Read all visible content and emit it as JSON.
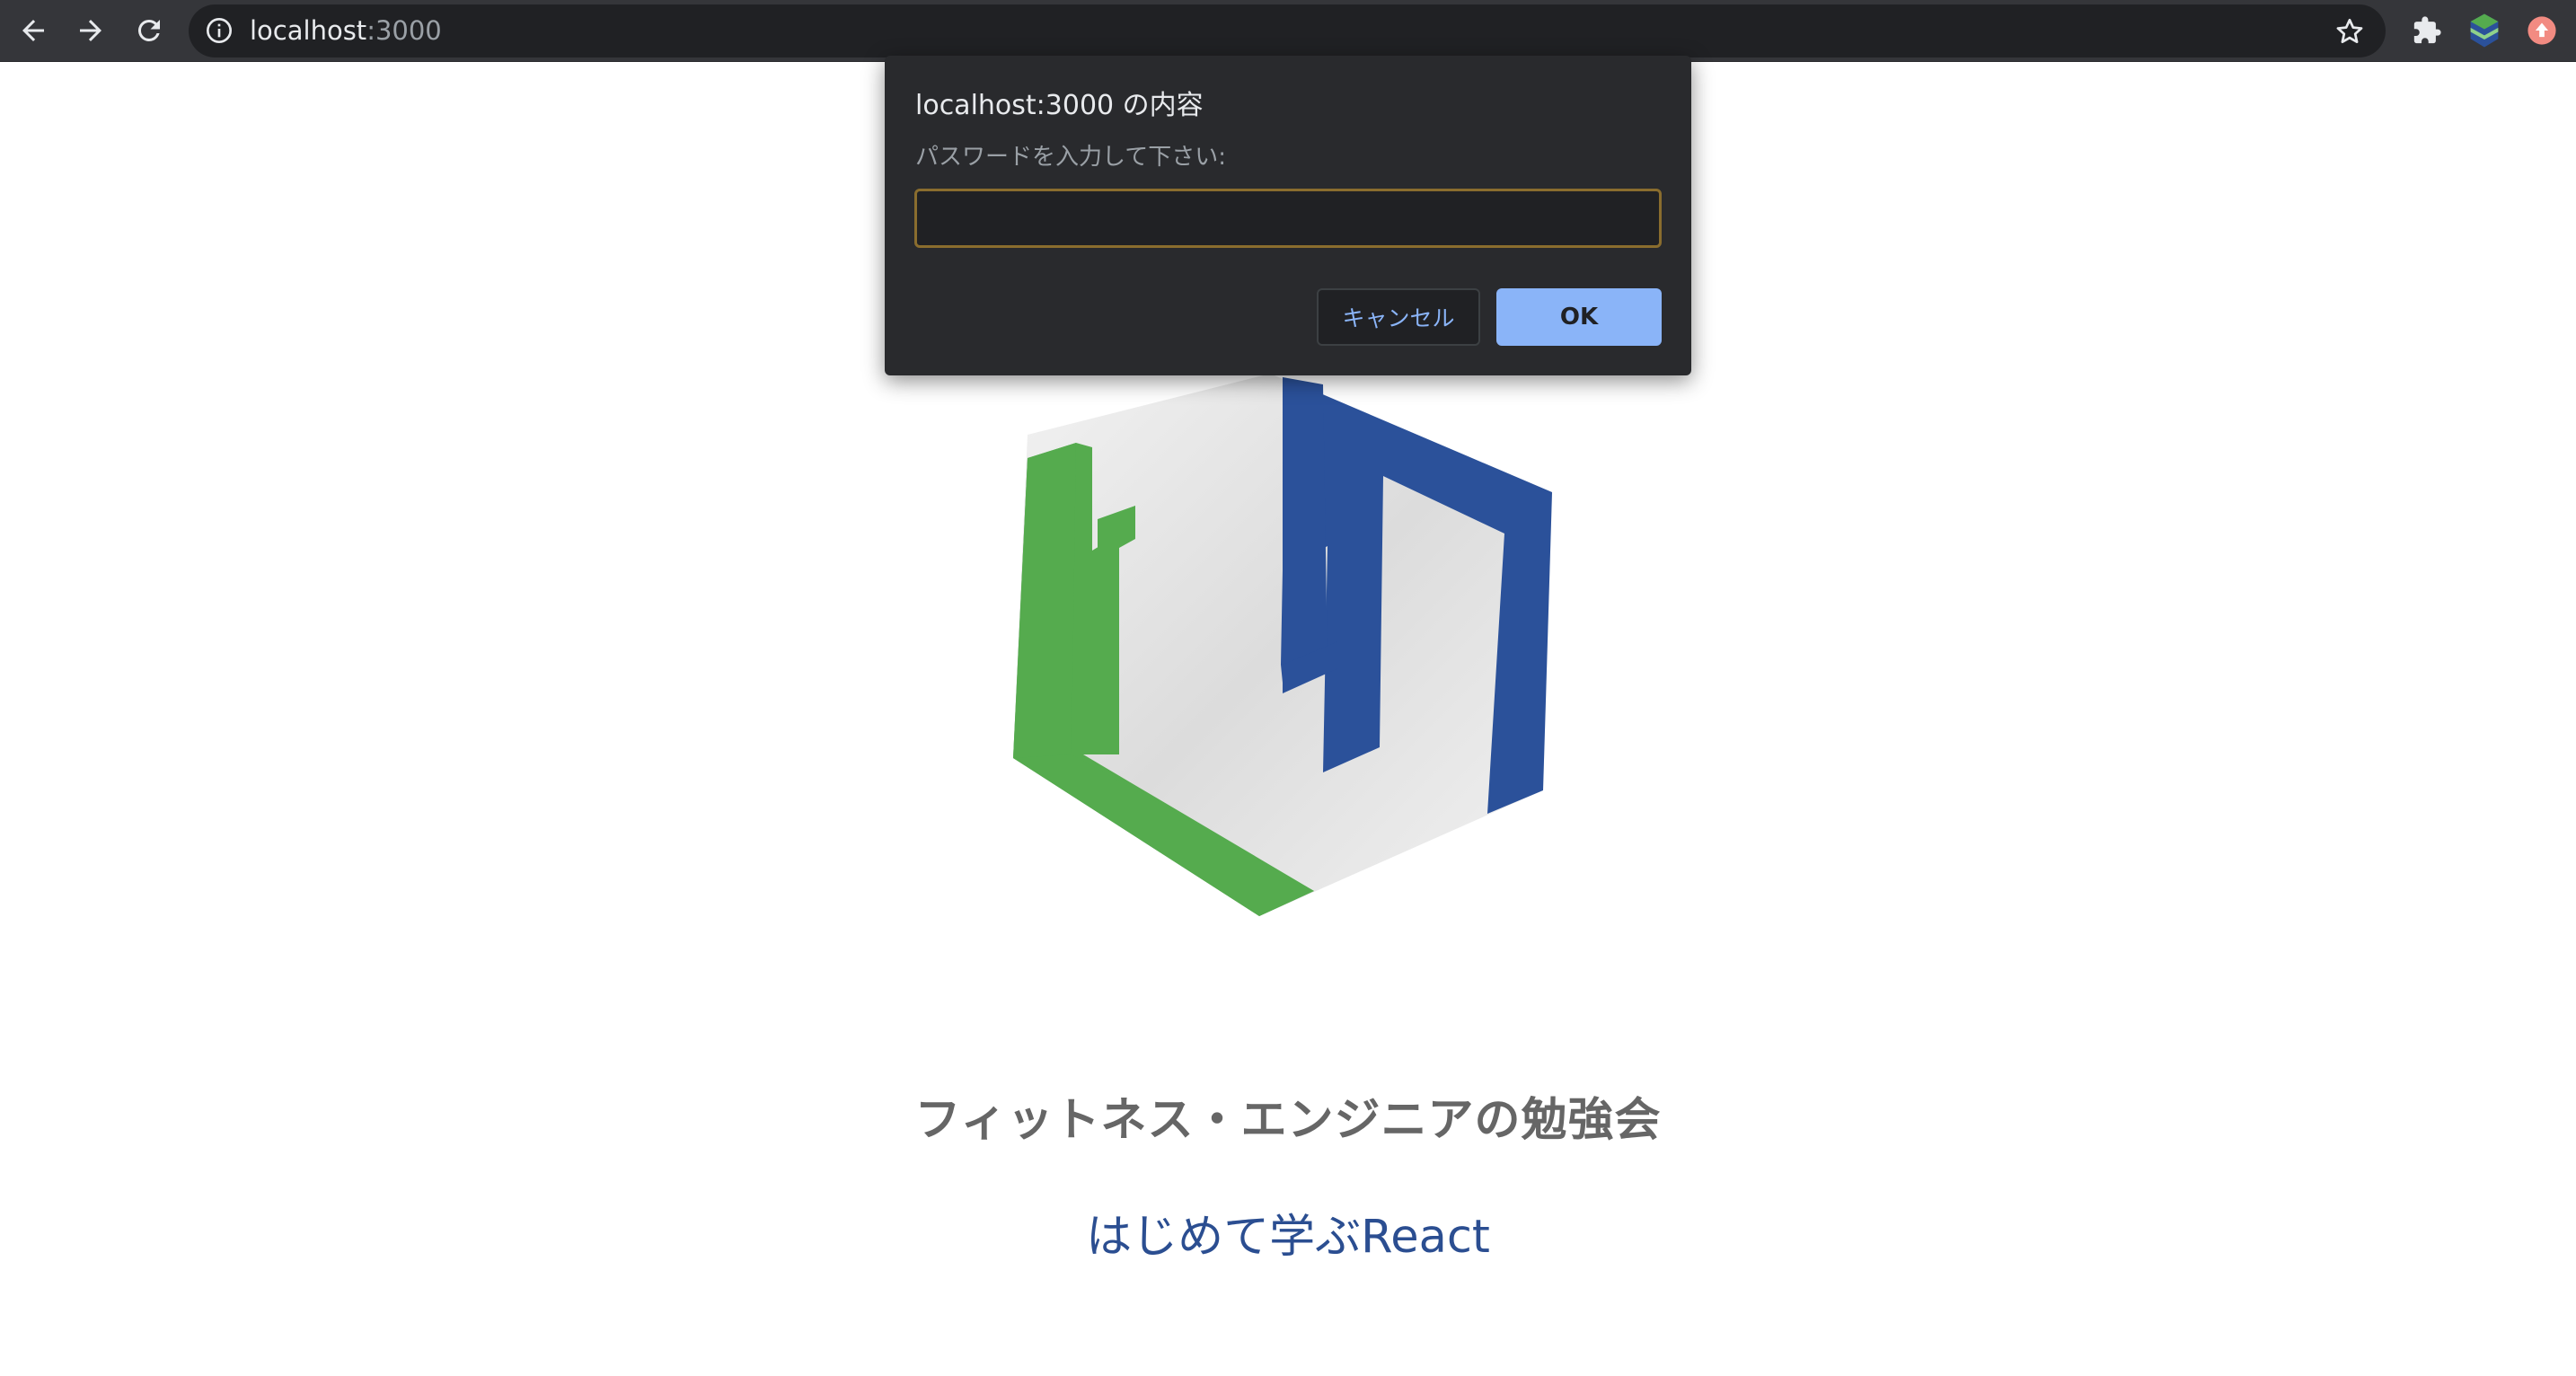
{
  "browser": {
    "url_host": "localhost",
    "url_port": ":3000",
    "back_icon": "arrow-left-icon",
    "forward_icon": "arrow-right-icon",
    "reload_icon": "reload-icon",
    "site_info_icon": "info-icon",
    "bookmark_icon": "star-icon",
    "extensions_icon": "puzzle-icon",
    "extension_icons": [
      "layered-hexagon-extension-icon",
      "red-circle-extension-icon"
    ]
  },
  "dialog": {
    "title": "localhost:3000 の内容",
    "message": "パスワードを入力して下さい:",
    "input_value": "",
    "cancel_label": "キャンセル",
    "ok_label": "OK"
  },
  "page": {
    "logo_icon": "hexagon-logo-icon",
    "subtitle": "フィットネス・エンジニアの勉強会",
    "heading": "はじめて学ぶReact"
  },
  "colors": {
    "toolbar_bg": "#35363a",
    "dialog_bg": "#292a2d",
    "ok_button": "#8ab4f8",
    "logo_green": "#55ab4e",
    "logo_blue": "#2b519a",
    "heading_blue": "#2b4e91",
    "subtitle_gray": "#666666"
  }
}
